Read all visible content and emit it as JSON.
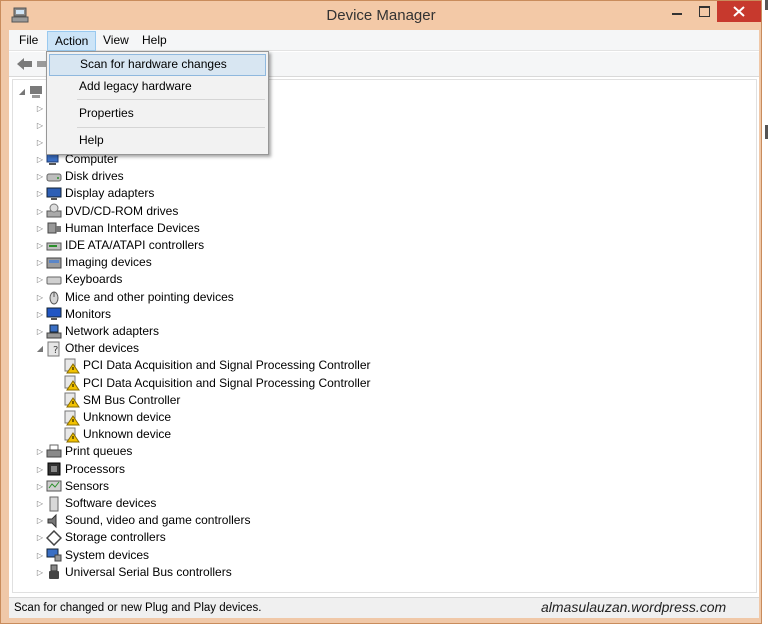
{
  "window": {
    "title": "Device Manager"
  },
  "menu": {
    "file": "File",
    "action": "Action",
    "view": "View",
    "help": "Help"
  },
  "action_menu": {
    "items": [
      "Scan for hardware changes",
      "Add legacy hardware",
      "Properties",
      "Help"
    ]
  },
  "tree": {
    "items": [
      "Computer",
      "Disk drives",
      "Display adapters",
      "DVD/CD-ROM drives",
      "Human Interface Devices",
      "IDE ATA/ATAPI controllers",
      "Imaging devices",
      "Keyboards",
      "Mice and other pointing devices",
      "Monitors",
      "Network adapters",
      "Other devices",
      "PCI Data Acquisition and Signal Processing Controller",
      "PCI Data Acquisition and Signal Processing Controller",
      "SM Bus Controller",
      "Unknown device",
      "Unknown device",
      "Print queues",
      "Processors",
      "Sensors",
      "Software devices",
      "Sound, video and game controllers",
      "Storage controllers",
      "System devices",
      "Universal Serial Bus controllers"
    ]
  },
  "status": {
    "text": "Scan for changed or new Plug and Play devices.",
    "watermark": "almasulauzan.wordpress.com"
  },
  "colors": {
    "frame": "#f3c9a7",
    "close": "#c7392d",
    "highlight": "#d8e6f2",
    "warning": "#f2c200"
  }
}
